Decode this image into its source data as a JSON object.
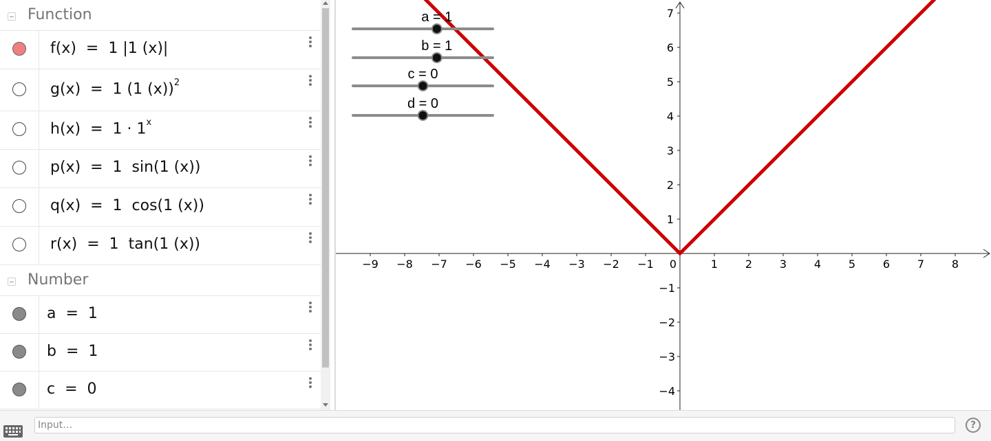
{
  "algebra": {
    "groups": [
      {
        "title": "Function",
        "items": [
          {
            "expr_html": "f(x) &nbsp;= &nbsp;1 |1 (x)|",
            "visible": true
          },
          {
            "expr_html": "g(x) &nbsp;= &nbsp;1 (1 (x))<sup>2</sup>",
            "visible": false
          },
          {
            "expr_html": "h(x) &nbsp;= &nbsp;1 · 1<sup>x</sup>",
            "visible": false
          },
          {
            "expr_html": "p(x) &nbsp;= &nbsp;1 &nbsp;sin(1 (x))",
            "visible": false
          },
          {
            "expr_html": "q(x) &nbsp;= &nbsp;1 &nbsp;cos(1 (x))",
            "visible": false
          },
          {
            "expr_html": "r(x) &nbsp;= &nbsp;1 &nbsp;tan(1 (x))",
            "visible": false
          }
        ]
      },
      {
        "title": "Number",
        "items": [
          {
            "expr_html": "a &nbsp;= &nbsp;1",
            "visible": true
          },
          {
            "expr_html": "b &nbsp;= &nbsp;1",
            "visible": true
          },
          {
            "expr_html": "c &nbsp;= &nbsp;0",
            "visible": true
          }
        ]
      }
    ]
  },
  "sliders": [
    {
      "label": "a = 1",
      "value": 1,
      "min": -5,
      "max": 5
    },
    {
      "label": "b = 1",
      "value": 1,
      "min": -5,
      "max": 5
    },
    {
      "label": "c = 0",
      "value": 0,
      "min": -5,
      "max": 5
    },
    {
      "label": "d = 0",
      "value": 0,
      "min": -5,
      "max": 5
    }
  ],
  "graph": {
    "curve_color": "#cc0000",
    "x_ticks": [
      "−9",
      "−8",
      "−7",
      "−6",
      "−5",
      "−4",
      "−3",
      "−2",
      "−1",
      "0",
      "1",
      "2",
      "3",
      "4",
      "5",
      "6",
      "7",
      "8"
    ],
    "y_ticks_pos": [
      "1",
      "2",
      "3",
      "4",
      "5",
      "6",
      "7"
    ],
    "y_ticks_neg": [
      "−1",
      "−2",
      "−3",
      "−4"
    ],
    "function": "f(x) = 1 |1 (x)|"
  },
  "input": {
    "placeholder": "Input…"
  },
  "help_label": "?"
}
